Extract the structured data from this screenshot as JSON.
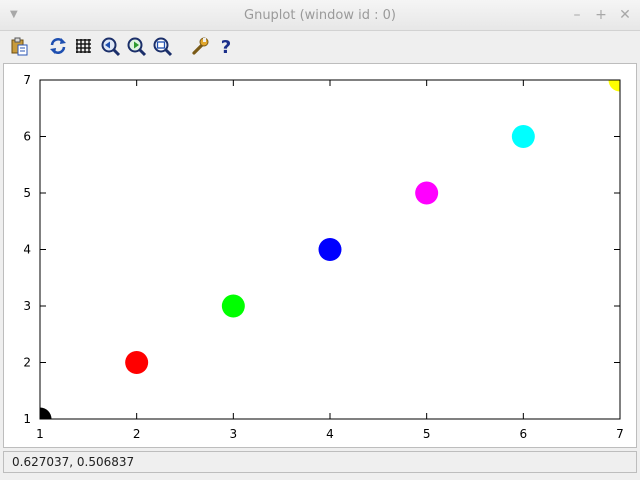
{
  "window": {
    "title": "Gnuplot (window id : 0)",
    "controls": [
      "minimize-icon",
      "maximize-icon",
      "close-icon"
    ]
  },
  "toolbar": {
    "buttons": [
      {
        "name": "copy-to-clipboard-button",
        "icon": "clipboard-icon"
      },
      {
        "name": "replot-button",
        "icon": "refresh-icon"
      },
      {
        "name": "grid-button",
        "icon": "grid-icon"
      },
      {
        "name": "previous-zoom-button",
        "icon": "zoom-back-icon"
      },
      {
        "name": "next-zoom-button",
        "icon": "zoom-forward-icon"
      },
      {
        "name": "autoscale-button",
        "icon": "zoom-autoscale-icon"
      },
      {
        "name": "settings-button",
        "icon": "wrench-icon"
      },
      {
        "name": "help-button",
        "icon": "help-icon"
      }
    ]
  },
  "statusbar": {
    "coords": "0.627037,  0.506837"
  },
  "chart_data": {
    "type": "scatter",
    "x": [
      1,
      2,
      3,
      4,
      5,
      6,
      7
    ],
    "y": [
      1,
      2,
      3,
      4,
      5,
      6,
      7
    ],
    "colors": [
      "#000000",
      "#ff0000",
      "#00ff00",
      "#0000ff",
      "#ff00ff",
      "#00ffff",
      "#ffff00"
    ],
    "xlim": [
      1,
      7
    ],
    "ylim": [
      1,
      7
    ],
    "xticks": [
      "1",
      "2",
      "3",
      "4",
      "5",
      "6",
      "7"
    ],
    "yticks": [
      "1",
      "2",
      "3",
      "4",
      "5",
      "6",
      "7"
    ],
    "title": "",
    "xlabel": "",
    "ylabel": "",
    "grid": false
  }
}
